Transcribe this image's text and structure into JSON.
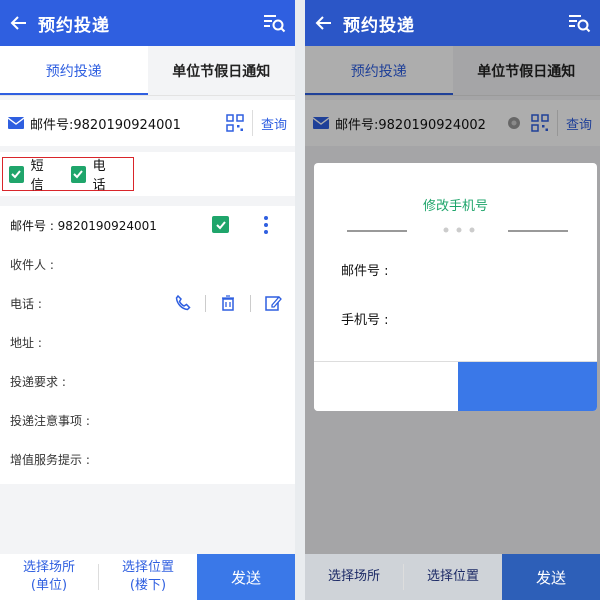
{
  "left": {
    "appbar": {
      "title": "预约投递"
    },
    "tabs": [
      {
        "label": "预约投递"
      },
      {
        "label": "单位节假日通知"
      }
    ],
    "search": {
      "mail_no": "邮件号:9820190924001",
      "query_label": "查询"
    },
    "checks": [
      {
        "label": "短信"
      },
      {
        "label": "电话"
      }
    ],
    "card": {
      "mail_label": "邮件号 : 9820190924001",
      "fields": [
        {
          "label": "收件人 :"
        },
        {
          "label": "电话 :"
        },
        {
          "label": "地址 :"
        },
        {
          "label": "投递要求 :"
        },
        {
          "label": "投递注意事项 :"
        },
        {
          "label": "增值服务提示 :"
        }
      ]
    },
    "bottom": {
      "place_line1": "选择场所",
      "place_line2": "(单位)",
      "pos_line1": "选择位置",
      "pos_line2": "(楼下)",
      "send": "发送"
    }
  },
  "right": {
    "appbar": {
      "title": "预约投递"
    },
    "tabs": [
      {
        "label": "预约投递"
      },
      {
        "label": "单位节假日通知"
      }
    ],
    "search": {
      "mail_no": "邮件号:9820190924002",
      "query_label": "查询"
    },
    "dialog": {
      "title": "修改手机号",
      "mail_label": "邮件号 :",
      "phone_label": "手机号 :"
    },
    "bottom": {
      "place": "选择场所",
      "pos": "选择位置",
      "send": "发送"
    }
  },
  "colors": {
    "primary": "#2f5fe0",
    "green": "#1fa56b",
    "highlight_red": "#d9252a",
    "send_blue": "#3a78e8"
  }
}
